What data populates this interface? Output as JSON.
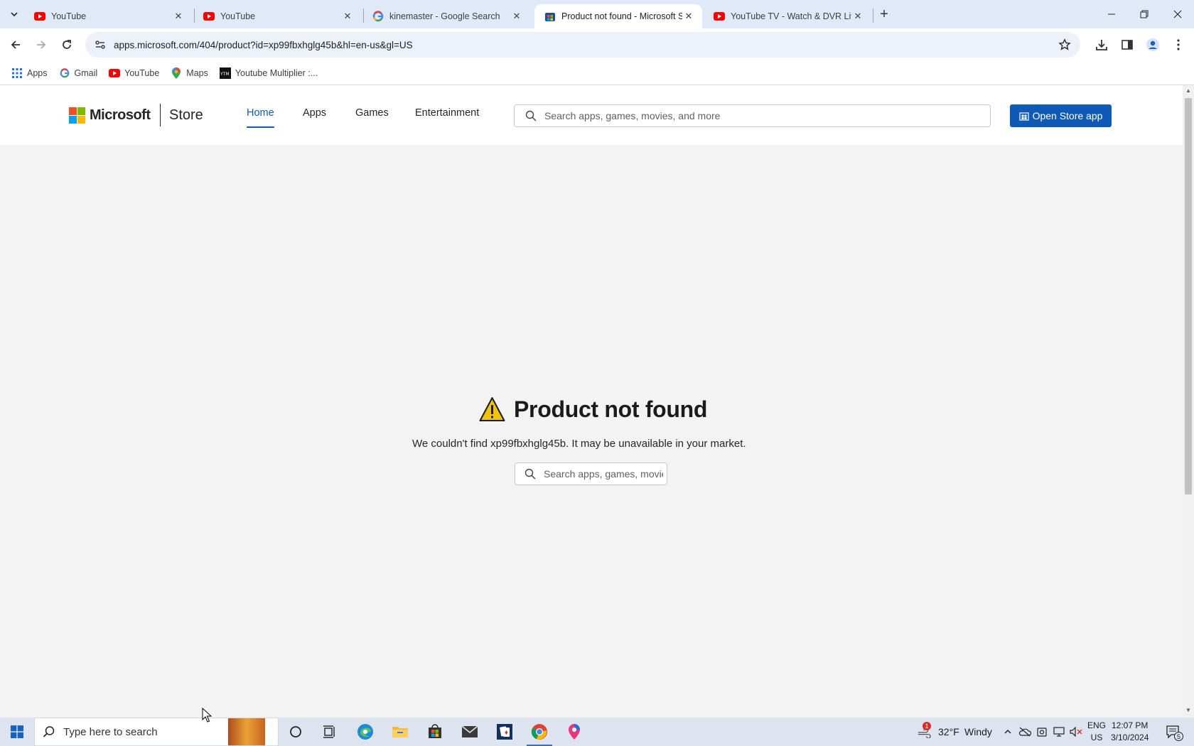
{
  "browser": {
    "tabs": [
      {
        "title": "YouTube",
        "favicon": "youtube-icon"
      },
      {
        "title": "YouTube",
        "favicon": "youtube-icon"
      },
      {
        "title": "kinemaster - Google Search",
        "favicon": "google-icon"
      },
      {
        "title": "Product not found - Microsoft Store",
        "favicon": "ms-store-icon",
        "active": true
      },
      {
        "title": "YouTube TV - Watch & DVR Live Sports",
        "favicon": "youtube-icon"
      }
    ],
    "address_bar": {
      "url": "apps.microsoft.com/404/product?id=xp99fbxhglg45b&hl=en-us&gl=US"
    },
    "bookmarks": [
      {
        "label": "Apps",
        "icon": "apps-grid-icon"
      },
      {
        "label": "Gmail",
        "icon": "google-icon"
      },
      {
        "label": "YouTube",
        "icon": "youtube-icon"
      },
      {
        "label": "Maps",
        "icon": "maps-pin-icon"
      },
      {
        "label": "Youtube Multiplier :...",
        "icon": "ytm-icon"
      }
    ]
  },
  "store": {
    "logo_text": "Microsoft",
    "store_text": "Store",
    "nav": [
      {
        "label": "Home",
        "active": true
      },
      {
        "label": "Apps"
      },
      {
        "label": "Games"
      },
      {
        "label": "Entertainment"
      }
    ],
    "search_placeholder": "Search apps, games, movies, and more",
    "open_store_label": "Open Store app",
    "not_found": {
      "title": "Product not found",
      "message": "We couldn't find xp99fbxhglg45b. It may be unavailable in your market.",
      "search_placeholder": "Search apps, games, movies, and more"
    }
  },
  "taskbar": {
    "search_placeholder": "Type here to search",
    "weather": {
      "temp": "32°F",
      "condition": "Windy",
      "badge": "1"
    },
    "language": {
      "line1": "ENG",
      "line2": "US"
    },
    "clock": {
      "time": "12:07 PM",
      "date": "3/10/2024"
    },
    "notification_count": "5"
  },
  "colors": {
    "accent": "#0f5ab7",
    "tabstrip": "#dfe9f8",
    "page_bg": "#f3f3f3",
    "warning": "#f2c400"
  }
}
